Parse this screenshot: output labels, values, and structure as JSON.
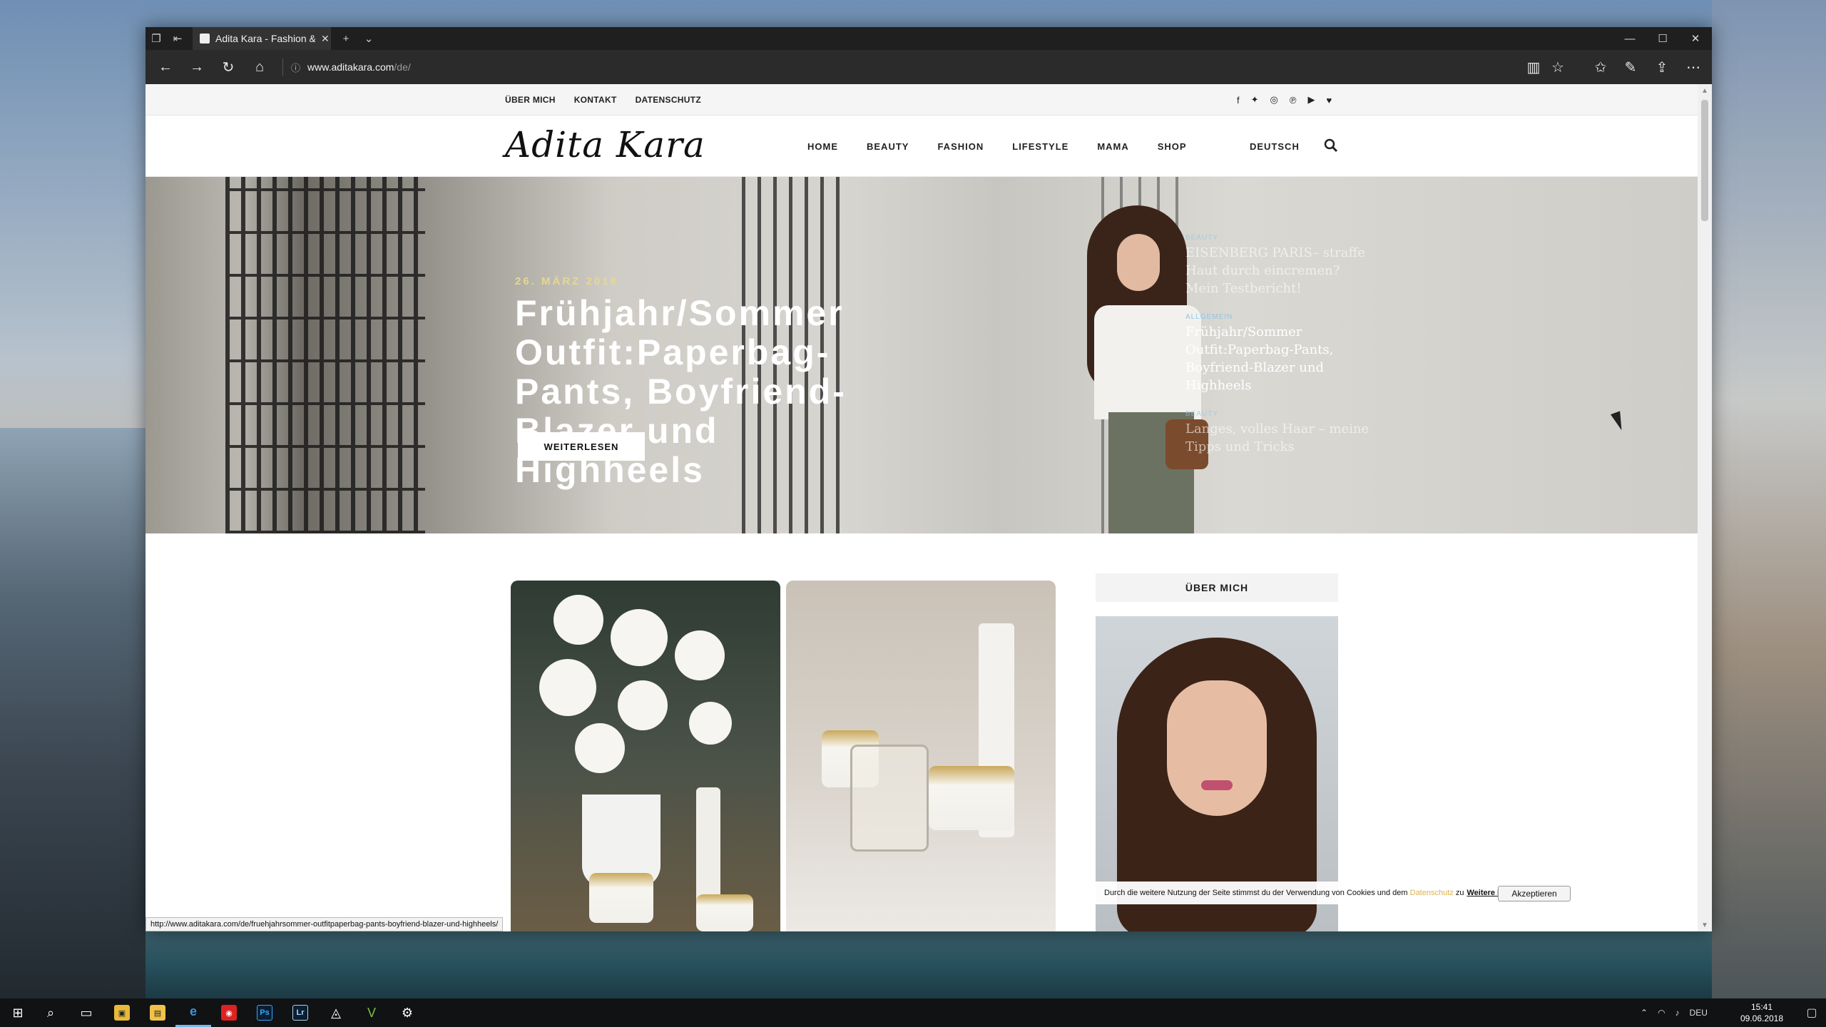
{
  "browser": {
    "tab_title": "Adita Kara - Fashion & l",
    "url_host": "www.aditakara.com",
    "url_path": "/de/",
    "status_url": "http://www.aditakara.com/de/fruehjahrsommer-outfitpaperbag-pants-boyfriend-blazer-und-highheels/"
  },
  "site": {
    "toplinks": [
      "ÜBER MICH",
      "KONTAKT",
      "DATENSCHUTZ"
    ],
    "logo": "Adita Kara",
    "nav": [
      "HOME",
      "BEAUTY",
      "FASHION",
      "LIFESTYLE",
      "MAMA",
      "SHOP"
    ],
    "language": "DEUTSCH",
    "social_icons": [
      "facebook-icon",
      "twitter-icon",
      "instagram-icon",
      "pinterest-icon",
      "youtube-icon",
      "heart-icon"
    ]
  },
  "hero": {
    "date": "26. MÄRZ 2018",
    "title": "Frühjahr/Sommer Outfit:Paperbag-Pants, Boyfriend-Blazer und Highheels",
    "button": "WEITERLESEN",
    "side_posts": [
      {
        "category": "BEAUTY",
        "title": "EISENBERG PARIS– straffe Haut durch eincremen? Mein Testbericht!"
      },
      {
        "category": "ALLGEMEIN",
        "title": "Frühjahr/Sommer Outfit:Paperbag-Pants, Boyfriend-Blazer und Highheels"
      },
      {
        "category": "BEAUTY",
        "title": "Langes, volles Haar – meine Tipps und Tricks"
      }
    ]
  },
  "sidebar": {
    "about_heading": "ÜBER MICH"
  },
  "cookie": {
    "text_before": "Durch die weitere Nutzung der Seite stimmst du der Verwendung von Cookies und dem",
    "link": "Datenschutz",
    "text_after": "zu",
    "more": "Weitere Informationen",
    "accept": "Akzeptieren"
  },
  "taskbar": {
    "lang": "DEU",
    "time": "15:41",
    "date": "09.06.2018"
  }
}
